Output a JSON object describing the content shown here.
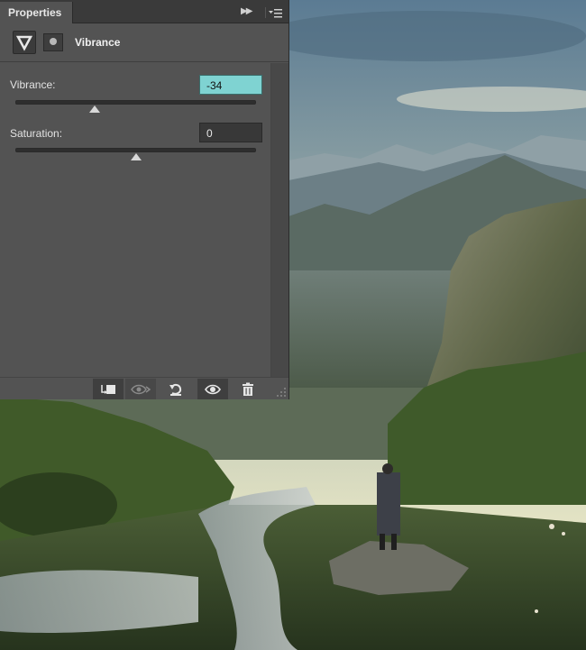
{
  "panel": {
    "tab_label": "Properties",
    "header_title": "Vibrance",
    "adjustment_icon": "vibrance-triangle-icon",
    "mask_icon": "layer-mask-icon"
  },
  "controls": {
    "vibrance": {
      "label": "Vibrance:",
      "value": "-34",
      "slider_fraction": 0.33
    },
    "saturation": {
      "label": "Saturation:",
      "value": "0",
      "slider_fraction": 0.5
    }
  },
  "footer_buttons": [
    {
      "name": "clip-to-layer-button",
      "icon": "clip-layer-icon"
    },
    {
      "name": "view-previous-state-button",
      "icon": "eye-compare-icon"
    },
    {
      "name": "reset-button",
      "icon": "reset-arrow-icon"
    },
    {
      "name": "toggle-visibility-button",
      "icon": "eye-icon"
    },
    {
      "name": "delete-button",
      "icon": "trash-icon"
    }
  ],
  "colors": {
    "panel_bg": "#535353",
    "active_field": "#7fd3d2"
  }
}
